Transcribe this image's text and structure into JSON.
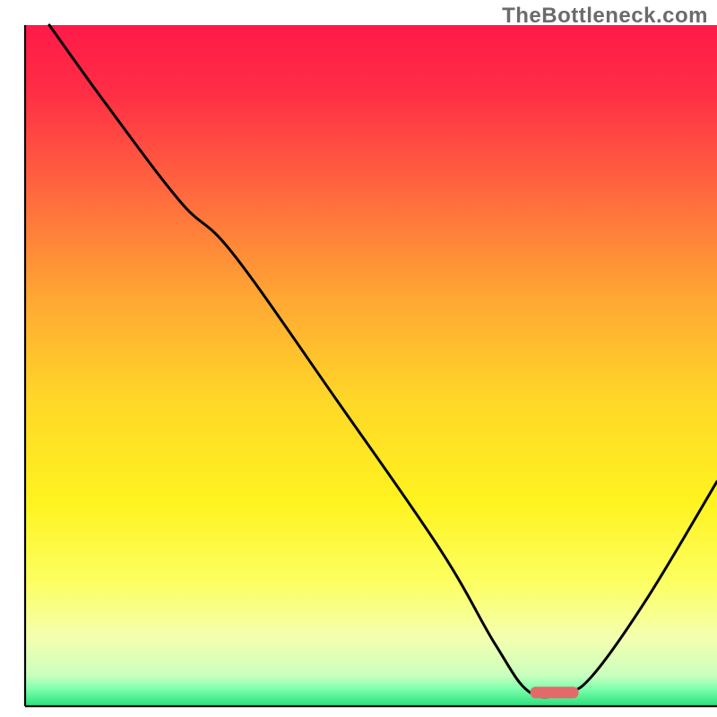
{
  "watermark": "TheBottleneck.com",
  "chart_data": {
    "type": "line",
    "title": "",
    "xlabel": "",
    "ylabel": "",
    "xlim": [
      0,
      100
    ],
    "ylim": [
      0,
      100
    ],
    "gradient_stops": [
      {
        "offset": 0.0,
        "color": "#ff1a48"
      },
      {
        "offset": 0.1,
        "color": "#ff2e45"
      },
      {
        "offset": 0.25,
        "color": "#ff6a3e"
      },
      {
        "offset": 0.4,
        "color": "#ffa733"
      },
      {
        "offset": 0.55,
        "color": "#ffd728"
      },
      {
        "offset": 0.7,
        "color": "#fff31f"
      },
      {
        "offset": 0.82,
        "color": "#fcff63"
      },
      {
        "offset": 0.9,
        "color": "#f4ffb0"
      },
      {
        "offset": 0.955,
        "color": "#c9ffbe"
      },
      {
        "offset": 0.975,
        "color": "#7dffad"
      },
      {
        "offset": 1.0,
        "color": "#26e07a"
      }
    ],
    "curve": {
      "x": [
        3.5,
        12.0,
        22.5,
        30.0,
        45.0,
        60.0,
        68.0,
        73.0,
        78.0,
        82.0,
        90.0,
        100.0
      ],
      "y": [
        100.0,
        88.0,
        74.0,
        66.5,
        45.0,
        23.0,
        9.0,
        2.0,
        2.0,
        4.5,
        16.0,
        33.0
      ]
    },
    "marker": {
      "x_start": 73.0,
      "x_end": 80.0,
      "y": 2.0,
      "color": "#e46a6a"
    },
    "axes": {
      "left_x": 3.5,
      "right_x": 100.0,
      "top_y": 100.0,
      "bottom_y": 1.0,
      "stroke": "#000000",
      "stroke_width": 2.2
    }
  }
}
